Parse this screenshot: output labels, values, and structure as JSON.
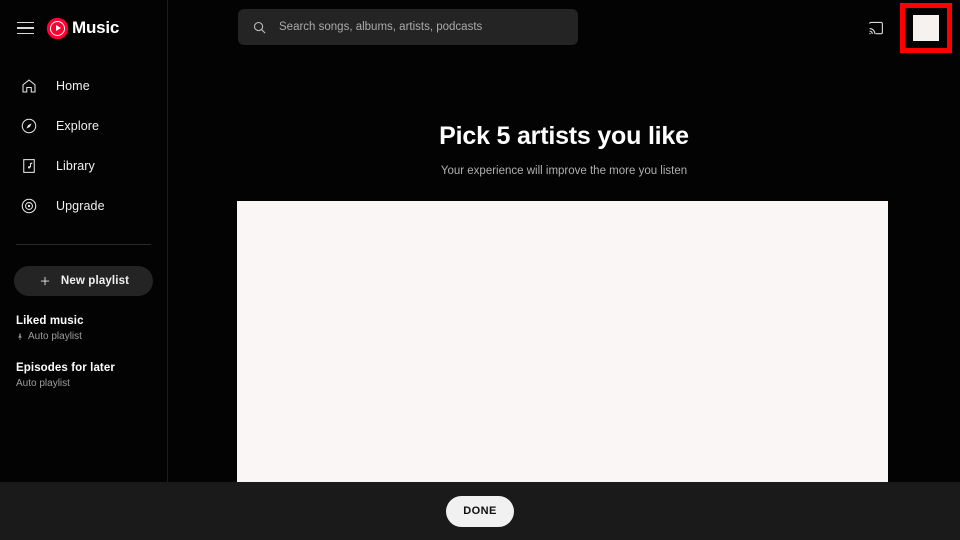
{
  "app": {
    "name": "Music",
    "logo_icon": "youtube-music-logo-icon",
    "menu_icon": "hamburger-menu-icon",
    "accent_color": "#ff0033",
    "background_color": "#030303",
    "highlight_color": "#ff0000"
  },
  "search": {
    "placeholder": "Search songs, albums, artists, podcasts",
    "value": "",
    "icon": "search-icon"
  },
  "topbar": {
    "cast_icon": "cast-icon",
    "avatar_icon": "avatar-icon"
  },
  "sidebar": {
    "items": [
      {
        "label": "Home",
        "icon": "home-icon"
      },
      {
        "label": "Explore",
        "icon": "compass-icon"
      },
      {
        "label": "Library",
        "icon": "library-music-icon"
      },
      {
        "label": "Upgrade",
        "icon": "upgrade-circle-icon"
      }
    ],
    "new_playlist": {
      "label": "New playlist",
      "icon": "plus-icon"
    },
    "playlists": [
      {
        "title": "Liked music",
        "subtitle": "Auto playlist",
        "icon": "pin-icon",
        "has_pin": true
      },
      {
        "title": "Episodes for later",
        "subtitle": "Auto playlist",
        "has_pin": false
      }
    ]
  },
  "main": {
    "headline": "Pick 5 artists you like",
    "subhead": "Your experience will improve the more you listen",
    "panel": {
      "name": "artist-selection-panel",
      "background_color": "#faf6f5",
      "content": ""
    }
  },
  "bottombar": {
    "done_label": "DONE"
  }
}
